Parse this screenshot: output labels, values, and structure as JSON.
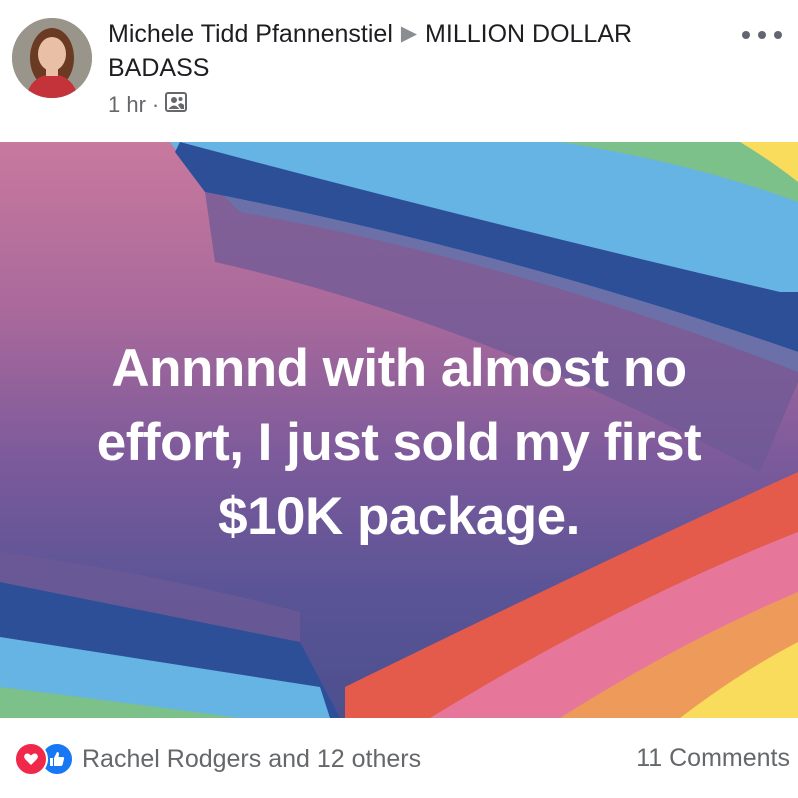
{
  "post": {
    "author": "Michele Tidd Pfannenstiel",
    "share_arrow": "▶",
    "group": "MILLION DOLLAR BADASS",
    "time": "1 hr",
    "separator": "·",
    "audience_icon": "group-audience-icon",
    "more_icon": "more-options-icon"
  },
  "card": {
    "lines": [
      "Annnnd with almost no",
      "effort, I just sold my first",
      "$10K package."
    ],
    "background_colors": {
      "pink": "#c8799e",
      "purple": "#7c5a9b",
      "blue": "#4c4f8e",
      "stripe_red": "#e45b4c",
      "stripe_orange": "#ee9a5a",
      "stripe_yellow": "#f9dc5c",
      "stripe_green": "#7cc08a",
      "stripe_lightblue": "#66b4e4",
      "stripe_darkblue": "#2d4f98"
    }
  },
  "footer": {
    "reactions": [
      "love",
      "like"
    ],
    "reactions_text": "Rachel Rodgers and 12 others",
    "comments_text": "11 Comments"
  }
}
